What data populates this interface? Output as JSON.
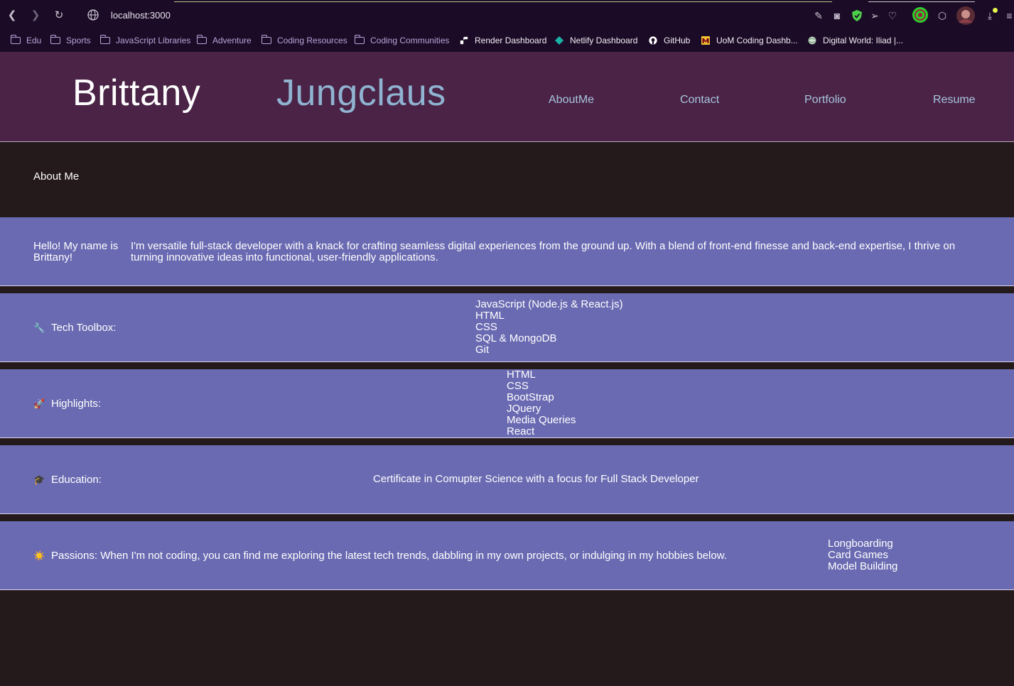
{
  "browser": {
    "url": "localhost:3000",
    "bookmarks": [
      {
        "label": "Edu",
        "type": "folder"
      },
      {
        "label": "Sports",
        "type": "folder"
      },
      {
        "label": "JavaScript Libraries",
        "type": "folder"
      },
      {
        "label": "Adventure",
        "type": "folder"
      },
      {
        "label": "Coding Resources",
        "type": "folder"
      },
      {
        "label": "Coding Communities",
        "type": "folder"
      },
      {
        "label": "Render Dashboard",
        "type": "link"
      },
      {
        "label": "Netlify Dashboard",
        "type": "link"
      },
      {
        "label": "GitHub",
        "type": "link"
      },
      {
        "label": "UoM Coding Dashb...",
        "type": "link"
      },
      {
        "label": "Digital World: Iliad |...",
        "type": "link"
      }
    ]
  },
  "header": {
    "first_name": "Brittany",
    "last_name": "Jungclaus",
    "nav": [
      "AboutMe",
      "Contact",
      "Portfolio",
      "Resume"
    ]
  },
  "about": {
    "title": "About Me",
    "hello": "Hello! My name is Brittany!",
    "bio": "I'm versatile full-stack developer with a knack for crafting seamless digital experiences from the ground up. With a blend of front-end finesse and back-end expertise, I thrive on turning innovative ideas into functional, user-friendly applications."
  },
  "toolbox": {
    "label": "Tech Toolbox:",
    "items": [
      "JavaScript (Node.js & React.js)",
      "HTML",
      "CSS",
      "SQL & MongoDB",
      "Git"
    ]
  },
  "highlights": {
    "label": "Highlights:",
    "items": [
      "HTML",
      "CSS",
      "BootStrap",
      "JQuery",
      "Media Queries",
      "React"
    ]
  },
  "education": {
    "label": "Education:",
    "text": "Certificate in Comupter Science with a focus for Full Stack Developer"
  },
  "passions": {
    "label": "Passions: When I'm not coding, you can find me exploring the latest tech trends, dabbling in my own projects, or indulging in my hobbies below.",
    "items": [
      "Longboarding",
      "Card Games",
      "Model Building"
    ]
  },
  "colors": {
    "chrome": "#1c0b26",
    "header": "#4a2346",
    "band": "#6a6ab2",
    "page": "#241a1c",
    "nav_link": "#a7c4de",
    "last_name": "#8fb3d1"
  }
}
